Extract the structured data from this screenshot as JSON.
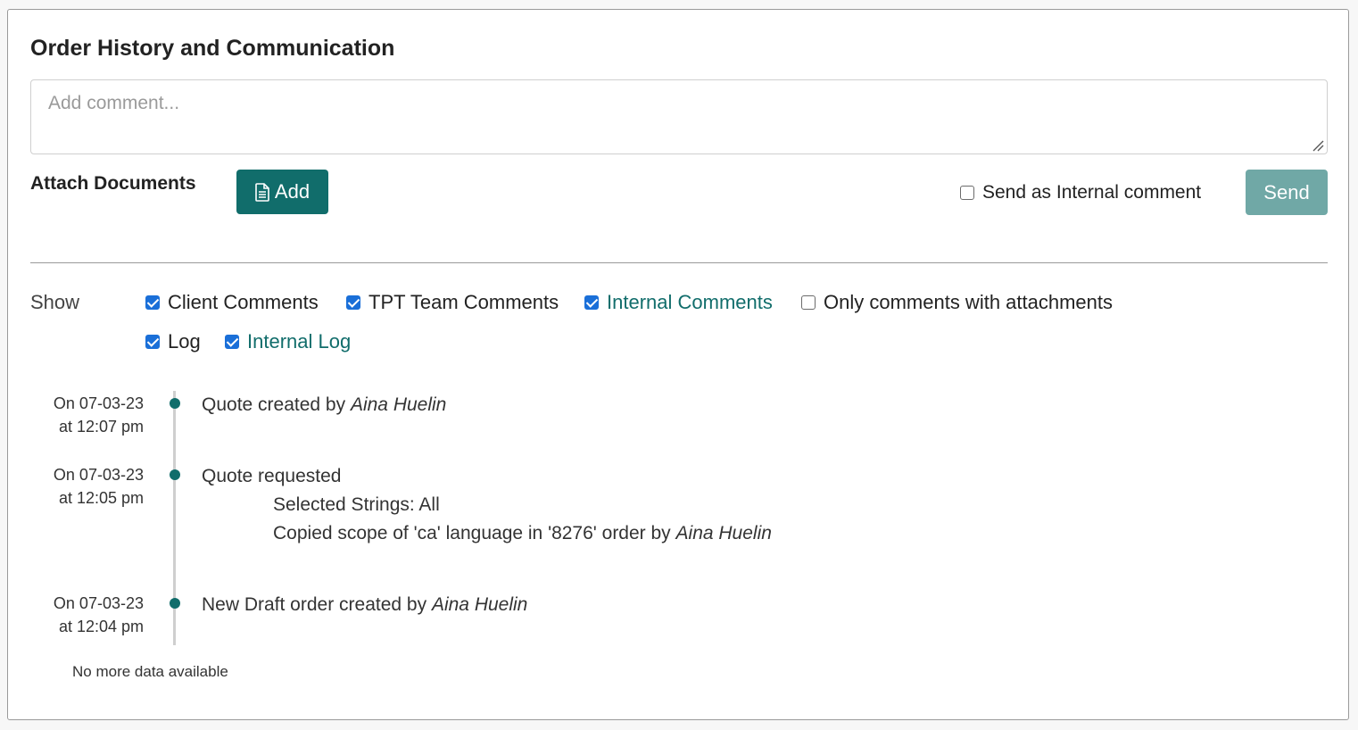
{
  "header": {
    "title": "Order History and Communication"
  },
  "comment": {
    "placeholder": "Add comment...",
    "value": ""
  },
  "attach": {
    "label": "Attach Documents",
    "add_label": "Add"
  },
  "internal_toggle": {
    "label": "Send as Internal comment",
    "checked": false
  },
  "send": {
    "label": "Send"
  },
  "show": {
    "label": "Show",
    "filters": [
      {
        "label": "Client Comments",
        "checked": true
      },
      {
        "label": "TPT Team Comments",
        "checked": true
      },
      {
        "label": "Internal Comments",
        "checked": true
      },
      {
        "label": "Only comments with attachments",
        "checked": false
      },
      {
        "label": "Log",
        "checked": true
      },
      {
        "label": "Internal Log",
        "checked": true
      }
    ]
  },
  "timeline": [
    {
      "date": "On 07-03-23",
      "time": "at 12:07 pm",
      "text": "Quote created by",
      "author": "Aina Huelin",
      "details": []
    },
    {
      "date": "On 07-03-23",
      "time": "at 12:05 pm",
      "text": "Quote requested",
      "author": "",
      "details": [
        {
          "text": "Selected Strings: All",
          "author": ""
        },
        {
          "text": "Copied scope of 'ca' language in '8276' order by",
          "author": "Aina Huelin"
        }
      ]
    },
    {
      "date": "On 07-03-23",
      "time": "at 12:04 pm",
      "text": "New Draft order created by",
      "author": "Aina Huelin",
      "details": []
    }
  ],
  "footer": {
    "no_more": "No more data available"
  },
  "colors": {
    "accent": "#116d6b",
    "send_disabled": "#70a8a6",
    "checkbox": "#1a6fd8"
  }
}
